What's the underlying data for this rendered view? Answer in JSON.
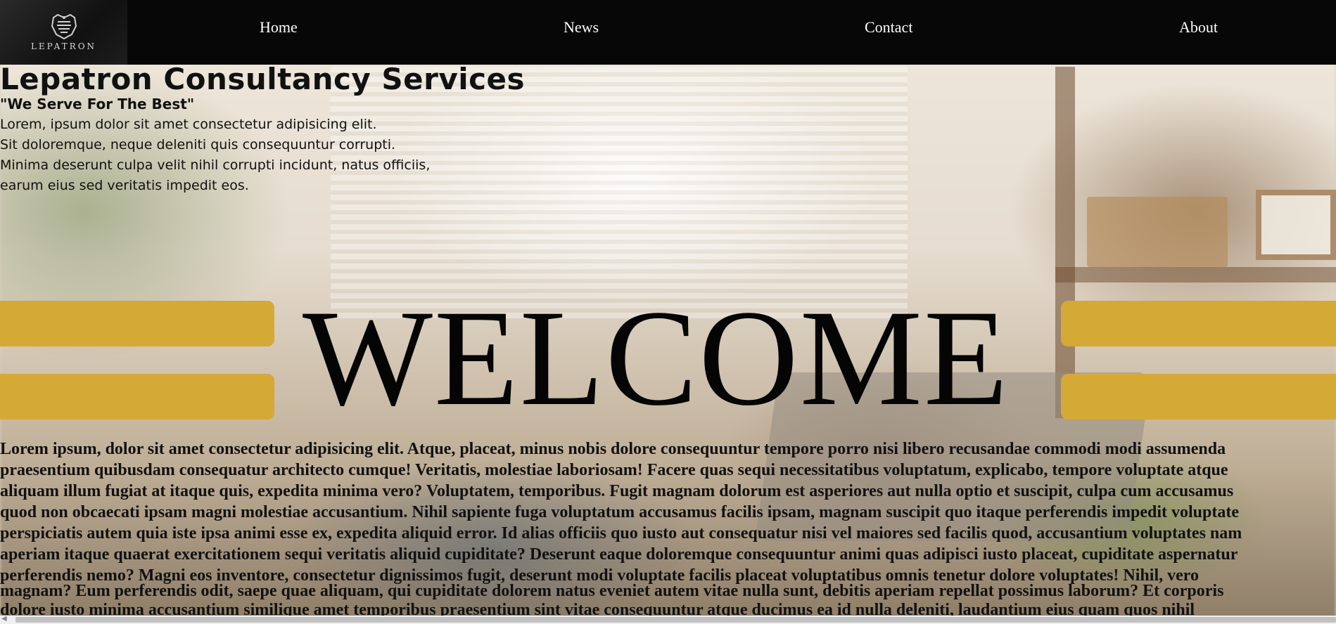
{
  "nav": {
    "logo_text": "LEPATRON",
    "links": [
      "Home",
      "News",
      "Contact",
      "About"
    ]
  },
  "hero": {
    "company_name": "Lepatron Consultancy Services",
    "tagline": "\"We Serve For The Best\"",
    "intro_lines": [
      "Lorem, ipsum dolor sit amet consectetur adipisicing elit.",
      "Sit doloremque, neque deleniti quis consequuntur corrupti.",
      "Minima deserunt culpa velit nihil corrupti incidunt, natus officiis,",
      "earum eius sed veritatis impedit eos."
    ],
    "welcome": "WELCOME"
  },
  "content": {
    "lines": [
      "Lorem ipsum, dolor sit amet consectetur adipisicing elit. Atque, placeat, minus nobis dolore consequuntur tempore porro nisi libero recusandae commodi modi assumenda",
      "praesentium quibusdam consequatur architecto cumque! Veritatis, molestiae laboriosam! Facere quas sequi necessitatibus voluptatum, explicabo, tempore voluptate atque",
      "aliquam illum fugiat at itaque quis, expedita minima vero? Voluptatem, temporibus. Fugit magnam dolorum est asperiores aut nulla optio et suscipit, culpa cum accusamus",
      "quod non obcaecati ipsam magni molestiae accusantium. Nihil sapiente fuga voluptatum accusamus facilis ipsam, magnam suscipit quo itaque perferendis impedit voluptate",
      "perspiciatis autem quia iste ipsa animi esse ex, expedita aliquid error. Id alias officiis quo iusto aut consequatur nisi vel maiores sed facilis quod, accusantium voluptates nam",
      "aperiam itaque quaerat exercitationem sequi veritatis aliquid cupiditate? Deserunt eaque doloremque consequuntur animi quas adipisci iusto placeat, cupiditate aspernatur",
      "perferendis nemo? Magni eos inventore, consectetur dignissimos fugit, deserunt modi voluptate facilis placeat voluptatibus omnis tenetur dolore voluptates! Nihil, vero"
    ],
    "overlap_lines": [
      "magnam? Eum perferendis odit, saepe quae aliquam, qui cupiditate dolorem natus eveniet autem vitae nulla sunt, debitis aperiam repellat possimus laborum? Et corporis",
      "dolore iusto minima accusantium similique amet temporibus praesentium sint vitae consequuntur atque ducimus ea id nulla deleniti, laudantium eius quam quos nihil"
    ]
  },
  "colors": {
    "nav_bg": "#070707",
    "accent_bar": "#d4a935",
    "text": "#111111"
  }
}
